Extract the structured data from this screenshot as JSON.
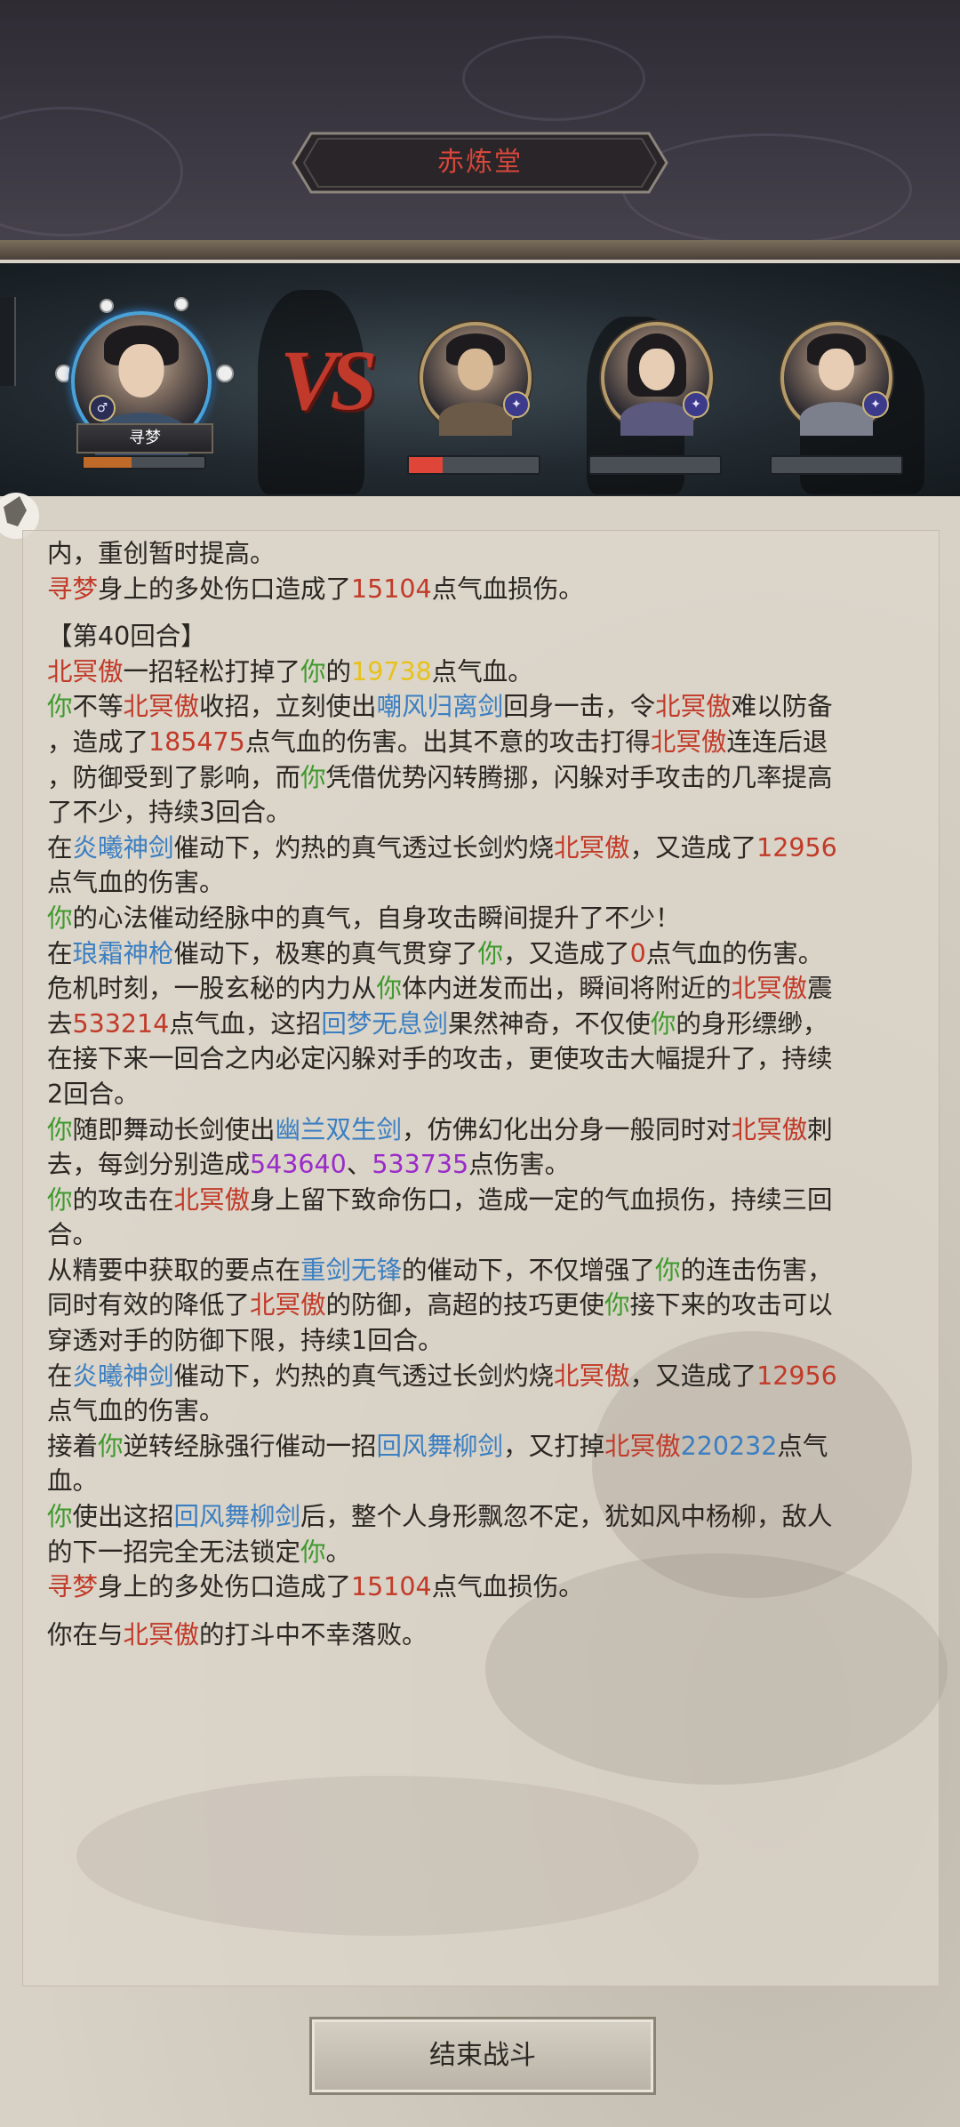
{
  "header": {
    "title": "赤炼堂"
  },
  "player": {
    "name": "寻梦",
    "gender_icon": "male-icon",
    "hp_fraction": 0.4
  },
  "enemies": [
    {
      "portrait": "bearded-warrior-portrait",
      "hp_fraction": 0.26
    },
    {
      "portrait": "long-haired-swordsman-portrait",
      "hp_fraction": 0.0
    },
    {
      "portrait": "scholar-swordsman-portrait",
      "hp_fraction": 0.0
    }
  ],
  "vs_label": "VS",
  "colors": {
    "you": "#3e9a2c",
    "enemy": "#c23a28",
    "skill": "#3b7fc2",
    "damage": "#c23a28",
    "highlight": "#e8c21a",
    "multi": "#9a2cc8"
  },
  "log": [
    [
      {
        "t": "内，重创暂时提高。"
      }
    ],
    [
      {
        "t": "寻梦",
        "c": "red"
      },
      {
        "t": "身上的多处伤口造成了"
      },
      {
        "t": "15104",
        "c": "red"
      },
      {
        "t": "点气血损伤。"
      }
    ],
    "gap",
    [
      {
        "t": "【第40回合】"
      }
    ],
    [
      {
        "t": "北冥傲",
        "c": "enemy"
      },
      {
        "t": "一招轻松打掉了"
      },
      {
        "t": "你",
        "c": "you"
      },
      {
        "t": "的"
      },
      {
        "t": "19738",
        "c": "yellow"
      },
      {
        "t": "点气血。"
      }
    ],
    [
      {
        "t": "你",
        "c": "you"
      },
      {
        "t": "不等"
      },
      {
        "t": "北冥傲",
        "c": "enemy"
      },
      {
        "t": "收招，立刻使出"
      },
      {
        "t": "嘲风归离剑",
        "c": "blue"
      },
      {
        "t": "回身一击，令"
      },
      {
        "t": "北冥傲",
        "c": "enemy"
      },
      {
        "t": "难以防备"
      }
    ],
    [
      {
        "t": "，造成了"
      },
      {
        "t": "185475",
        "c": "red"
      },
      {
        "t": "点气血的伤害。出其不意的攻击打得"
      },
      {
        "t": "北冥傲",
        "c": "enemy"
      },
      {
        "t": "连连后退"
      }
    ],
    [
      {
        "t": "，防御受到了影响，而"
      },
      {
        "t": "你",
        "c": "you"
      },
      {
        "t": "凭借优势闪转腾挪，闪躲对手攻击的几率提高"
      }
    ],
    [
      {
        "t": "了不少，持续3回合。"
      }
    ],
    [
      {
        "t": "在"
      },
      {
        "t": "炎曦神剑",
        "c": "blue"
      },
      {
        "t": "催动下，灼热的真气透过长剑灼烧"
      },
      {
        "t": "北冥傲",
        "c": "enemy"
      },
      {
        "t": "，又造成了"
      },
      {
        "t": "12956",
        "c": "red"
      }
    ],
    [
      {
        "t": "点气血的伤害。"
      }
    ],
    [
      {
        "t": "你",
        "c": "you"
      },
      {
        "t": "的心法催动经脉中的真气，自身攻击瞬间提升了不少！"
      }
    ],
    [
      {
        "t": "在"
      },
      {
        "t": "琅霜神枪",
        "c": "blue"
      },
      {
        "t": "催动下，极寒的真气贯穿了"
      },
      {
        "t": "你",
        "c": "you"
      },
      {
        "t": "，又造成了"
      },
      {
        "t": "0",
        "c": "red"
      },
      {
        "t": "点气血的伤害。"
      }
    ],
    [
      {
        "t": "危机时刻，一股玄秘的内力从"
      },
      {
        "t": "你",
        "c": "you"
      },
      {
        "t": "体内迸发而出，瞬间将附近的"
      },
      {
        "t": "北冥傲",
        "c": "enemy"
      },
      {
        "t": "震"
      }
    ],
    [
      {
        "t": "去"
      },
      {
        "t": "533214",
        "c": "red"
      },
      {
        "t": "点气血，这招"
      },
      {
        "t": "回梦无息剑",
        "c": "blue"
      },
      {
        "t": "果然神奇，不仅使"
      },
      {
        "t": "你",
        "c": "you"
      },
      {
        "t": "的身形缥缈，"
      }
    ],
    [
      {
        "t": "在接下来一回合之内必定闪躲对手的攻击，更使攻击大幅提升了，持续"
      }
    ],
    [
      {
        "t": "2回合。"
      }
    ],
    [
      {
        "t": "你",
        "c": "you"
      },
      {
        "t": "随即舞动长剑使出"
      },
      {
        "t": "幽兰双生剑",
        "c": "blue"
      },
      {
        "t": "，仿佛幻化出分身一般同时对"
      },
      {
        "t": "北冥傲",
        "c": "enemy"
      },
      {
        "t": "刺"
      }
    ],
    [
      {
        "t": "去，每剑分别造成"
      },
      {
        "t": "543640",
        "c": "purple"
      },
      {
        "t": "、"
      },
      {
        "t": "533735",
        "c": "purple"
      },
      {
        "t": "点伤害。"
      }
    ],
    [
      {
        "t": "你",
        "c": "you"
      },
      {
        "t": "的攻击在"
      },
      {
        "t": "北冥傲",
        "c": "enemy"
      },
      {
        "t": "身上留下致命伤口，造成一定的气血损伤，持续三回"
      }
    ],
    [
      {
        "t": "合。"
      }
    ],
    [
      {
        "t": "从精要中获取的要点在"
      },
      {
        "t": "重剑无锋",
        "c": "blue"
      },
      {
        "t": "的催动下，不仅增强了"
      },
      {
        "t": "你",
        "c": "you"
      },
      {
        "t": "的连击伤害，"
      }
    ],
    [
      {
        "t": "同时有效的降低了"
      },
      {
        "t": "北冥傲",
        "c": "enemy"
      },
      {
        "t": "的防御，高超的技巧更使"
      },
      {
        "t": "你",
        "c": "you"
      },
      {
        "t": "接下来的攻击可以"
      }
    ],
    [
      {
        "t": "穿透对手的防御下限，持续1回合。"
      }
    ],
    [
      {
        "t": "在"
      },
      {
        "t": "炎曦神剑",
        "c": "blue"
      },
      {
        "t": "催动下，灼热的真气透过长剑灼烧"
      },
      {
        "t": "北冥傲",
        "c": "enemy"
      },
      {
        "t": "，又造成了"
      },
      {
        "t": "12956",
        "c": "red"
      }
    ],
    [
      {
        "t": "点气血的伤害。"
      }
    ],
    [
      {
        "t": "接着"
      },
      {
        "t": "你",
        "c": "you"
      },
      {
        "t": "逆转经脉强行催动一招"
      },
      {
        "t": "回风舞柳剑",
        "c": "blue"
      },
      {
        "t": "，又打掉"
      },
      {
        "t": "北冥傲",
        "c": "enemy"
      },
      {
        "t": "220232",
        "c": "blue"
      },
      {
        "t": "点气"
      }
    ],
    [
      {
        "t": "血。"
      }
    ],
    [
      {
        "t": "你",
        "c": "you"
      },
      {
        "t": "使出这招"
      },
      {
        "t": "回风舞柳剑",
        "c": "blue"
      },
      {
        "t": "后，整个人身形飘忽不定，犹如风中杨柳，敌人"
      }
    ],
    [
      {
        "t": "的下一招完全无法锁定"
      },
      {
        "t": "你",
        "c": "you"
      },
      {
        "t": "。"
      }
    ],
    [
      {
        "t": "寻梦",
        "c": "red"
      },
      {
        "t": "身上的多处伤口造成了"
      },
      {
        "t": "15104",
        "c": "red"
      },
      {
        "t": "点气血损伤。"
      }
    ],
    "gap",
    [
      {
        "t": "你在与"
      },
      {
        "t": "北冥傲",
        "c": "enemy"
      },
      {
        "t": "的打斗中不幸落败。"
      }
    ]
  ],
  "end_button": {
    "label": "结束战斗"
  }
}
